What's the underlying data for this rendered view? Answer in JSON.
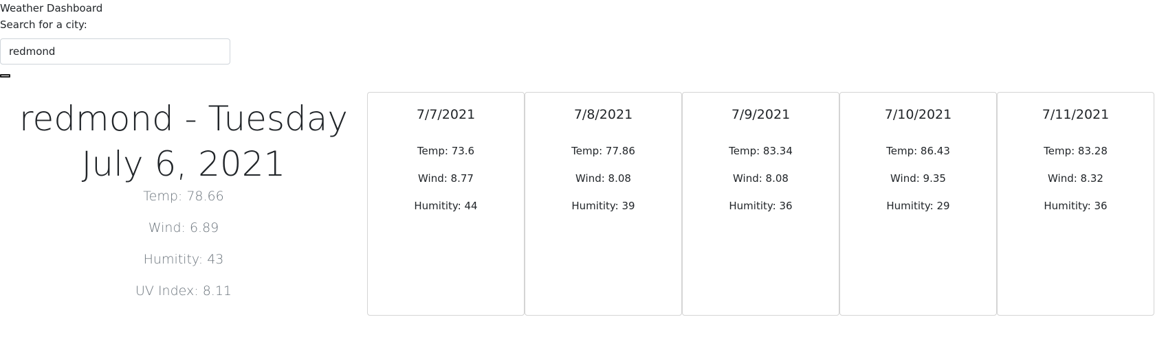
{
  "header": {
    "title": "Weather Dashboard"
  },
  "search": {
    "label": "Search for a city:",
    "value": "redmond",
    "button_label": ""
  },
  "current": {
    "title": "redmond - Tuesday July 6, 2021",
    "temp": "Temp: 78.66",
    "wind": "Wind: 6.89",
    "humidity": "Humitity: 43",
    "uv_index": "UV Index: 8.11"
  },
  "forecast": [
    {
      "date": "7/7/2021",
      "temp": "Temp: 73.6",
      "wind": "Wind: 8.77",
      "humidity": "Humitity: 44"
    },
    {
      "date": "7/8/2021",
      "temp": "Temp: 77.86",
      "wind": "Wind: 8.08",
      "humidity": "Humitity: 39"
    },
    {
      "date": "7/9/2021",
      "temp": "Temp: 83.34",
      "wind": "Wind: 8.08",
      "humidity": "Humitity: 36"
    },
    {
      "date": "7/10/2021",
      "temp": "Temp: 86.43",
      "wind": "Wind: 9.35",
      "humidity": "Humitity: 29"
    },
    {
      "date": "7/11/2021",
      "temp": "Temp: 83.28",
      "wind": "Wind: 8.32",
      "humidity": "Humitity: 36"
    }
  ]
}
